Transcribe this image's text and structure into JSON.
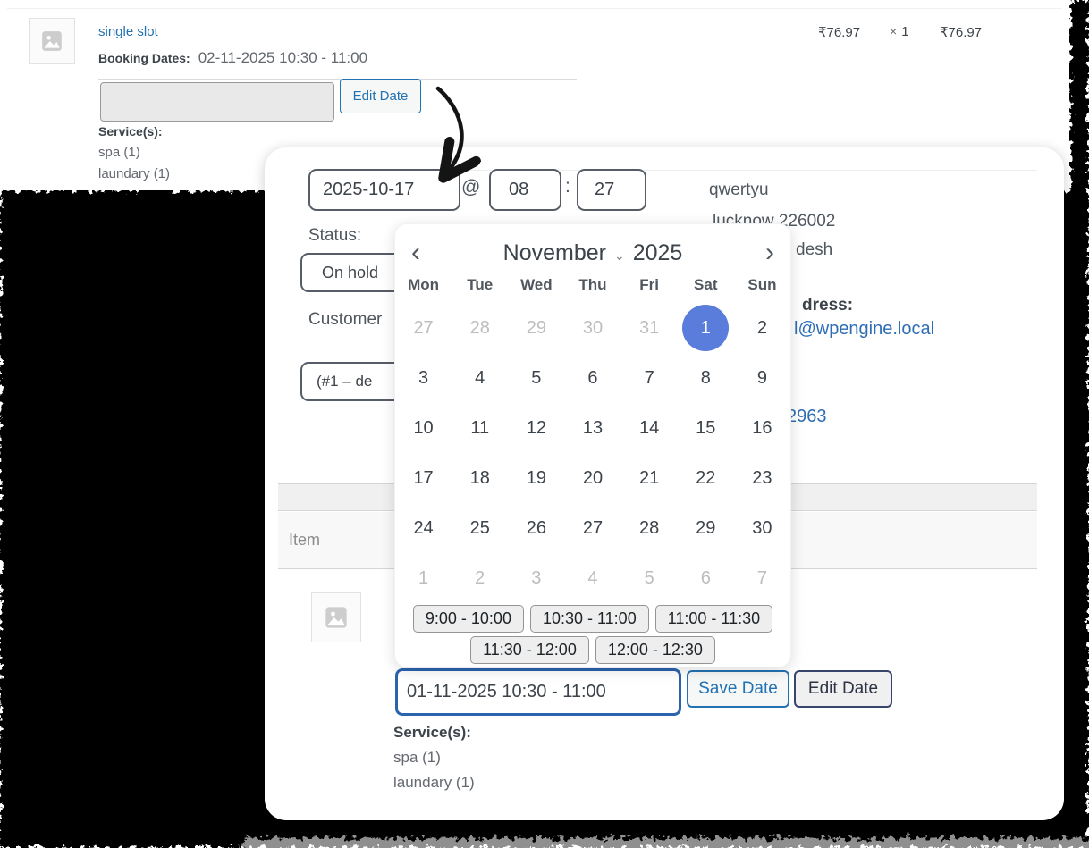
{
  "top_item": {
    "product": "single slot",
    "booking_label": "Booking Dates:",
    "booking_value": "02-11-2025 10:30 - 11:00",
    "edit_date_button": "Edit Date",
    "services_label": "Service(s):",
    "services": [
      "spa (1)",
      "laundary (1)"
    ],
    "cost": "₹76.97",
    "qty_sign": "×",
    "qty": "1",
    "total": "₹76.97"
  },
  "order_panel": {
    "date_value": "2025-10-17",
    "at_sign": "@",
    "hour": "08",
    "time_separator": ":",
    "minute": "27",
    "status_label": "Status:",
    "status_value": "On hold",
    "customer_label": "Customer",
    "customer_value": "(#1 – de",
    "billing_fragments": {
      "address_line": "qwertyu",
      "city_postcode": "lucknow 226002",
      "state_fragment": "desh",
      "email_label_fragment": "dress:",
      "email": "l@wpengine.local",
      "phone_fragment": "2963"
    },
    "items_table": {
      "item_header": "Item"
    }
  },
  "calendar": {
    "prev": "‹",
    "next": "›",
    "month": "November",
    "month_caret": "⌄",
    "year": "2025",
    "weekdays": [
      "Mon",
      "Tue",
      "Wed",
      "Thu",
      "Fri",
      "Sat",
      "Sun"
    ],
    "weeks": [
      [
        {
          "d": "27",
          "muted": true
        },
        {
          "d": "28",
          "muted": true
        },
        {
          "d": "29",
          "muted": true
        },
        {
          "d": "30",
          "muted": true
        },
        {
          "d": "31",
          "muted": true
        },
        {
          "d": "1",
          "selected": true
        },
        {
          "d": "2"
        }
      ],
      [
        {
          "d": "3"
        },
        {
          "d": "4"
        },
        {
          "d": "5"
        },
        {
          "d": "6"
        },
        {
          "d": "7"
        },
        {
          "d": "8"
        },
        {
          "d": "9"
        }
      ],
      [
        {
          "d": "10"
        },
        {
          "d": "11"
        },
        {
          "d": "12"
        },
        {
          "d": "13"
        },
        {
          "d": "14"
        },
        {
          "d": "15"
        },
        {
          "d": "16"
        }
      ],
      [
        {
          "d": "17"
        },
        {
          "d": "18"
        },
        {
          "d": "19"
        },
        {
          "d": "20"
        },
        {
          "d": "21"
        },
        {
          "d": "22"
        },
        {
          "d": "23"
        }
      ],
      [
        {
          "d": "24"
        },
        {
          "d": "25"
        },
        {
          "d": "26"
        },
        {
          "d": "27"
        },
        {
          "d": "28"
        },
        {
          "d": "29"
        },
        {
          "d": "30"
        }
      ],
      [
        {
          "d": "1",
          "muted": true
        },
        {
          "d": "2",
          "muted": true
        },
        {
          "d": "3",
          "muted": true
        },
        {
          "d": "4",
          "muted": true
        },
        {
          "d": "5",
          "muted": true
        },
        {
          "d": "6",
          "muted": true
        },
        {
          "d": "7",
          "muted": true
        }
      ]
    ],
    "slot_rows": [
      [
        "9:00 - 10:00",
        "10:30 - 11:00",
        "11:00 - 11:30"
      ],
      [
        "11:30 - 12:00",
        "12:00 - 12:30"
      ]
    ]
  },
  "booking_editor": {
    "value": "01-11-2025 10:30 - 11:00",
    "save_button": "Save Date",
    "edit_button": "Edit Date",
    "services_label": "Service(s):",
    "services": [
      "spa (1)",
      "laundary (1)"
    ]
  },
  "colors": {
    "accent_blue": "#2271b1",
    "selected_day_blue": "#5a7ddb",
    "link_blue": "#2f6eb5"
  }
}
